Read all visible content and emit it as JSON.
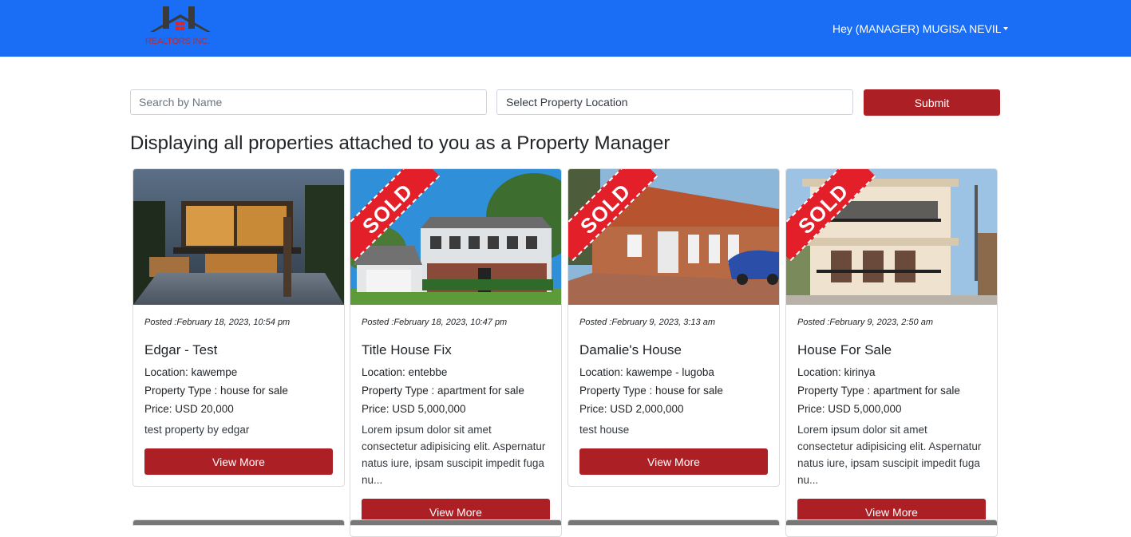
{
  "navbar": {
    "logo_text": "REALTORS INC.",
    "user_menu_label": "Hey (MANAGER) MUGISA NEVIL",
    "background": "#1a6ef5"
  },
  "search": {
    "name_placeholder": "Search by Name",
    "location_select": "Select Property Location",
    "submit_label": "Submit"
  },
  "heading": "Displaying all properties attached to you as a Property Manager",
  "properties": [
    {
      "posted": "Posted :February 18, 2023, 10:54 pm",
      "title": "Edgar - Test",
      "location": "Location: kawempe",
      "type": "Property Type : house for sale",
      "price": "Price: USD 20,000",
      "description": "test property by edgar",
      "sold": false,
      "button": "View More"
    },
    {
      "posted": "Posted :February 18, 2023, 10:47 pm",
      "title": "Title House Fix",
      "location": "Location: entebbe",
      "type": "Property Type : apartment for sale",
      "price": "Price: USD 5,000,000",
      "description": "Lorem ipsum dolor sit amet consectetur adipisicing elit. Aspernatur natus iure, ipsam suscipit impedit fuga nu...",
      "sold": true,
      "sold_label": "SOLD",
      "button": "View More"
    },
    {
      "posted": "Posted :February 9, 2023, 3:13 am",
      "title": "Damalie's House",
      "location": "Location: kawempe - lugoba",
      "type": "Property Type : house for sale",
      "price": "Price: USD 2,000,000",
      "description": "test house",
      "sold": true,
      "sold_label": "SOLD",
      "button": "View More"
    },
    {
      "posted": "Posted :February 9, 2023, 2:50 am",
      "title": "House For Sale",
      "location": "Location: kirinya",
      "type": "Property Type : apartment for sale",
      "price": "Price: USD 5,000,000",
      "description": "Lorem ipsum dolor sit amet consectetur adipisicing elit. Aspernatur natus iure, ipsam suscipit impedit fuga nu...",
      "sold": true,
      "sold_label": "SOLD",
      "button": "View More"
    }
  ],
  "colors": {
    "accent_red": "#ac1f24",
    "sold_ribbon": "#e3202a"
  }
}
